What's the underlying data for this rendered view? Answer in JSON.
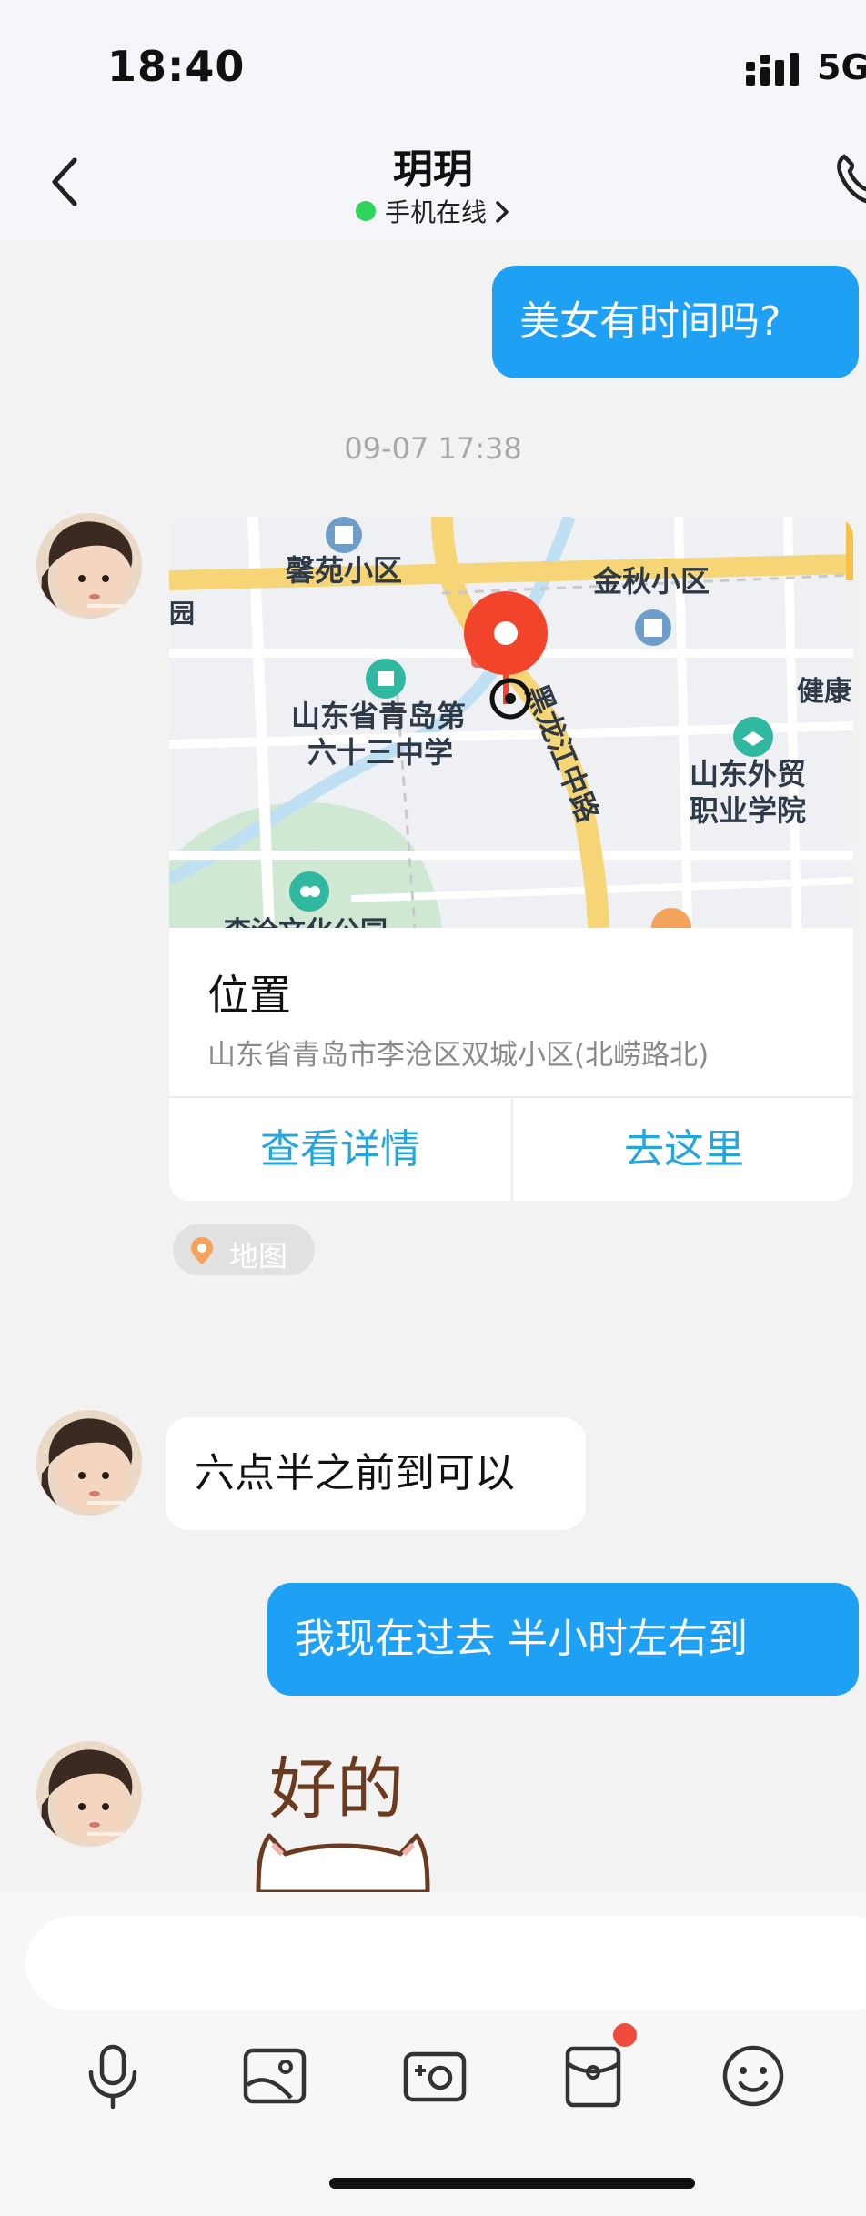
{
  "status_bar": {
    "time": "18:40",
    "network": "5G"
  },
  "header": {
    "title": "玥玥",
    "status": "手机在线"
  },
  "messages": {
    "m1": "美女有时间吗?",
    "timestamp": "09-07 17:38",
    "m3": "六点半之前到可以",
    "m4": "我现在过去   半小时左右到",
    "sticker_text": "好的"
  },
  "location": {
    "title": "位置",
    "address": "山东省青岛市李沧区双城小区(北崂路北)",
    "view_details": "查看详情",
    "go_here": "去这里",
    "tag_label": "地图",
    "map_labels": {
      "xinyuan": "馨苑小区",
      "jinqiu": "金秋小区",
      "school_line1": "山东省青岛第",
      "school_line2": "六十三中学",
      "road": "黑龙江中路",
      "jiankang": "健康",
      "college_line1": "山东外贸",
      "college_line2": "职业学院",
      "edge": "园",
      "park": "李沧文化公园"
    }
  },
  "colors": {
    "accent": "#1ea0f5",
    "online": "#2fd45a",
    "link": "#23a5dd",
    "pin": "#f2442a",
    "badge": "#f04b3a"
  },
  "toolbar": {
    "icons": [
      "microphone-icon",
      "image-icon",
      "camera-icon",
      "red-packet-icon",
      "emoji-icon"
    ]
  }
}
